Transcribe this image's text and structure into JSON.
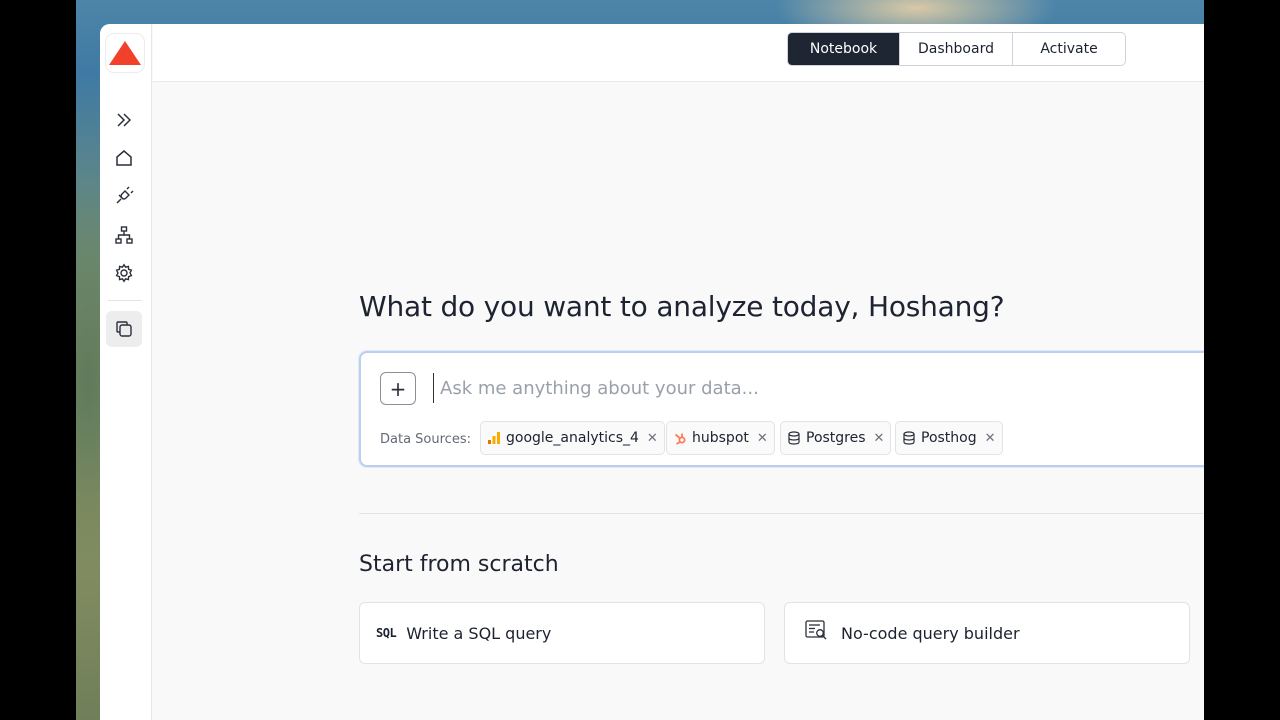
{
  "app": {
    "logo": "triangle-logo",
    "accent": "#f2412a"
  },
  "sidebar": {
    "items": [
      {
        "icon": "expand-chevrons-icon"
      },
      {
        "icon": "home-icon"
      },
      {
        "icon": "plug-icon"
      },
      {
        "icon": "hierarchy-icon"
      },
      {
        "icon": "gear-icon"
      },
      {
        "icon": "copy-stack-icon",
        "active": true
      }
    ]
  },
  "tabs": [
    {
      "label": "Notebook",
      "active": true
    },
    {
      "label": "Dashboard",
      "active": false
    },
    {
      "label": "Activate",
      "active": false
    }
  ],
  "main": {
    "headline": "What do you want to analyze today, Hoshang?",
    "ask": {
      "placeholder": "Ask me anything about your data...",
      "value": "",
      "plus_label": "+",
      "sources_label": "Data Sources:",
      "sources": [
        {
          "name": "google_analytics_4",
          "icon": "bar-chart-icon"
        },
        {
          "name": "hubspot",
          "icon": "hubspot-icon"
        },
        {
          "name": "Postgres",
          "icon": "database-icon"
        },
        {
          "name": "Posthog",
          "icon": "database-icon"
        }
      ]
    },
    "scratch": {
      "title": "Start from scratch",
      "cards": [
        {
          "label": "Write a SQL query",
          "icon_text": "SQL"
        },
        {
          "label": "No-code query builder",
          "icon": "query-builder-icon"
        }
      ]
    }
  }
}
